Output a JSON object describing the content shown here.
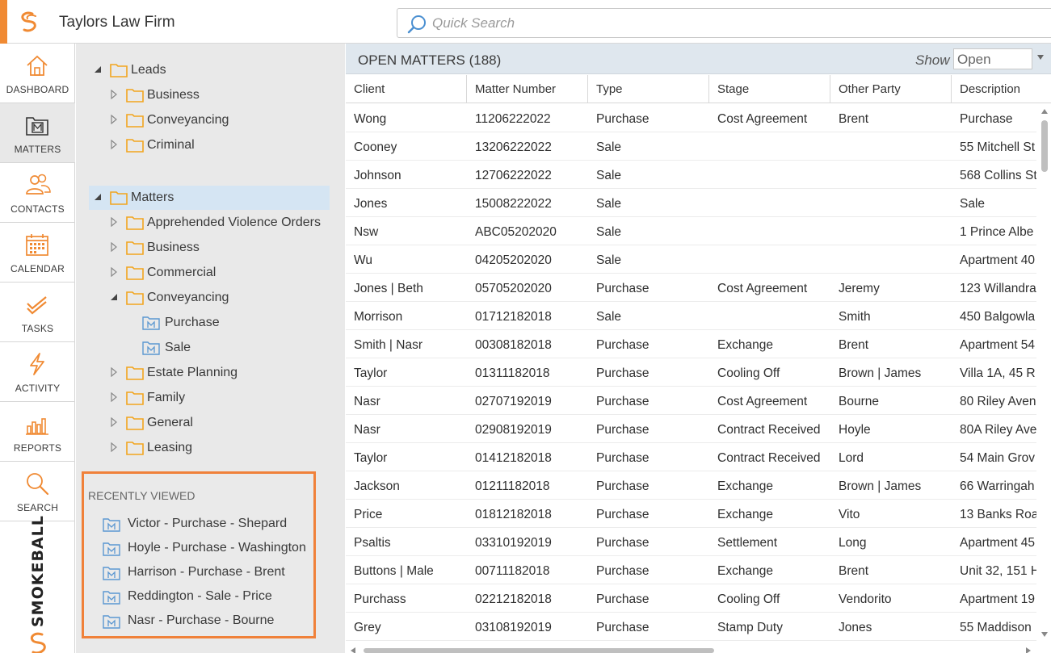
{
  "header": {
    "firm_name": "Taylors Law Firm",
    "search_placeholder": "Quick Search",
    "accent_color": "#f08a33"
  },
  "nav": {
    "items": [
      {
        "label": "DASHBOARD",
        "icon": "house-icon",
        "active": false
      },
      {
        "label": "MATTERS",
        "icon": "matter-folder-icon",
        "active": true
      },
      {
        "label": "CONTACTS",
        "icon": "contacts-icon",
        "active": false
      },
      {
        "label": "CALENDAR",
        "icon": "calendar-icon",
        "active": false
      },
      {
        "label": "TASKS",
        "icon": "tasks-check-icon",
        "active": false
      },
      {
        "label": "ACTIVITY",
        "icon": "lightning-icon",
        "active": false
      },
      {
        "label": "REPORTS",
        "icon": "bar-chart-icon",
        "active": false
      },
      {
        "label": "SEARCH",
        "icon": "search-icon",
        "active": false
      }
    ],
    "brand": "SMOKEBALL"
  },
  "tree": {
    "leads": {
      "label": "Leads",
      "children": [
        "Business",
        "Conveyancing",
        "Criminal"
      ]
    },
    "matters": {
      "label": "Matters",
      "children": [
        {
          "label": "Apprehended Violence Orders",
          "expanded": false
        },
        {
          "label": "Business",
          "expanded": false
        },
        {
          "label": "Commercial",
          "expanded": false
        },
        {
          "label": "Conveyancing",
          "expanded": true,
          "children": [
            "Purchase",
            "Sale"
          ]
        },
        {
          "label": "Estate Planning",
          "expanded": false
        },
        {
          "label": "Family",
          "expanded": false
        },
        {
          "label": "General",
          "expanded": false
        },
        {
          "label": "Leasing",
          "expanded": false
        }
      ]
    }
  },
  "recent": {
    "title": "RECENTLY VIEWED",
    "items": [
      "Victor - Purchase - Shepard",
      "Hoyle - Purchase - Washington",
      "Harrison - Purchase - Brent",
      "Reddington - Sale - Price",
      "Nasr - Purchase - Bourne"
    ]
  },
  "grid": {
    "title": "OPEN MATTERS (188)",
    "show_label": "Show",
    "show_value": "Open",
    "columns": [
      "Client",
      "Matter Number",
      "Type",
      "Stage",
      "Other Party",
      "Description"
    ],
    "rows": [
      [
        "Wong",
        "11206222022",
        "Purchase",
        "Cost Agreement",
        "Brent",
        "Purchase"
      ],
      [
        "Cooney",
        "13206222022",
        "Sale",
        "",
        "",
        "55 Mitchell St"
      ],
      [
        "Johnson",
        "12706222022",
        "Sale",
        "",
        "",
        "568 Collins St"
      ],
      [
        "Jones",
        "15008222022",
        "Sale",
        "",
        "",
        "Sale"
      ],
      [
        "Nsw",
        "ABC05202020",
        "Sale",
        "",
        "",
        "1 Prince Albe"
      ],
      [
        "Wu",
        "04205202020",
        "Sale",
        "",
        "",
        "Apartment 40"
      ],
      [
        "Jones | Beth",
        "05705202020",
        "Purchase",
        "Cost Agreement",
        "Jeremy",
        "123 Willandra"
      ],
      [
        "Morrison",
        "01712182018",
        "Sale",
        "",
        "Smith",
        "450 Balgowla"
      ],
      [
        "Smith | Nasr",
        "00308182018",
        "Purchase",
        "Exchange",
        "Brent",
        "Apartment 54"
      ],
      [
        "Taylor",
        "01311182018",
        "Purchase",
        "Cooling Off",
        "Brown | James",
        "Villa 1A, 45 R"
      ],
      [
        "Nasr",
        "02707192019",
        "Purchase",
        "Cost Agreement",
        "Bourne",
        "80 Riley Aven"
      ],
      [
        "Nasr",
        "02908192019",
        "Purchase",
        "Contract Received",
        "Hoyle",
        "80A Riley Ave"
      ],
      [
        "Taylor",
        "01412182018",
        "Purchase",
        "Contract Received",
        "Lord",
        "54 Main Grov"
      ],
      [
        "Jackson",
        "01211182018",
        "Purchase",
        "Exchange",
        "Brown | James",
        "66 Warringah"
      ],
      [
        "Price",
        "01812182018",
        "Purchase",
        "Exchange",
        "Vito",
        "13 Banks Roa"
      ],
      [
        "Psaltis",
        "03310192019",
        "Purchase",
        "Settlement",
        "Long",
        "Apartment 45"
      ],
      [
        "Buttons | Male",
        "00711182018",
        "Purchase",
        "Exchange",
        "Brent",
        "Unit 32, 151 H"
      ],
      [
        "Purchass",
        "02212182018",
        "Purchase",
        "Cooling Off",
        "Vendorito",
        "Apartment 19"
      ],
      [
        "Grey",
        "03108192019",
        "Purchase",
        "Stamp Duty",
        "Jones",
        "55 Maddison"
      ]
    ]
  }
}
